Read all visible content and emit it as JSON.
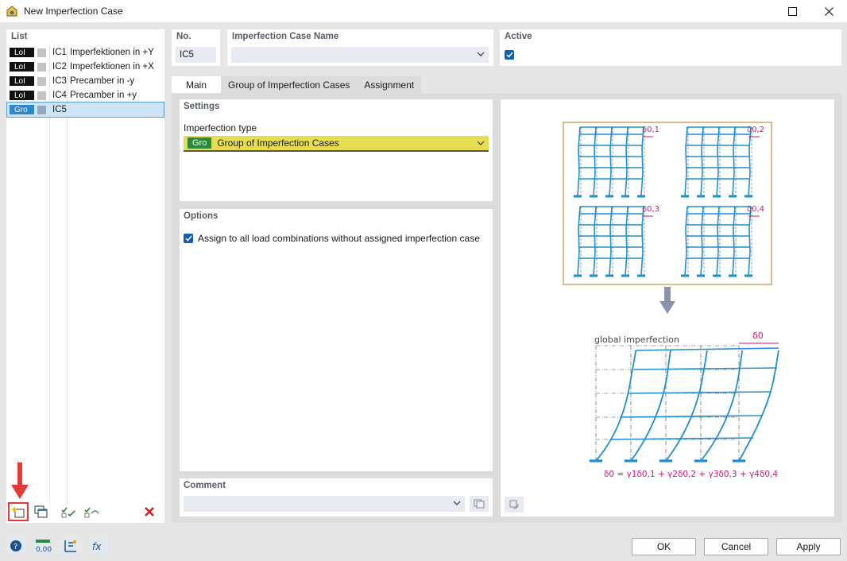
{
  "window": {
    "title": "New Imperfection Case"
  },
  "list": {
    "header": "List",
    "items": [
      {
        "tag": "LoI",
        "code": "IC1",
        "desc": "Imperfektionen in +Y",
        "selected": false
      },
      {
        "tag": "LoI",
        "code": "IC2",
        "desc": "Imperfektionen in +X",
        "selected": false
      },
      {
        "tag": "LoI",
        "code": "IC3",
        "desc": "Precamber in -y",
        "selected": false
      },
      {
        "tag": "LoI",
        "code": "IC4",
        "desc": "Precamber in +y",
        "selected": false
      },
      {
        "tag": "Gro",
        "code": "IC5",
        "desc": "",
        "selected": true
      }
    ]
  },
  "no": {
    "label": "No.",
    "value": "IC5"
  },
  "name": {
    "label": "Imperfection Case Name",
    "value": ""
  },
  "active": {
    "label": "Active",
    "checked": true
  },
  "tabs": [
    {
      "label": "Main",
      "active": true
    },
    {
      "label": "Group of Imperfection Cases",
      "active": false
    },
    {
      "label": "Assignment",
      "active": false
    }
  ],
  "settings": {
    "header": "Settings",
    "imperfection_type_label": "Imperfection type",
    "imperfection_type_tag": "Gro",
    "imperfection_type_value": "Group of Imperfection Cases"
  },
  "options": {
    "header": "Options",
    "assign_label": "Assign to all load combinations without assigned imperfection case",
    "assign_checked": true
  },
  "comment": {
    "header": "Comment",
    "value": ""
  },
  "diagram": {
    "labels": [
      "δ0,1",
      "δ0,2",
      "δ0,3",
      "δ0,4"
    ],
    "global_label": "global imperfection",
    "global_delta": "δ0",
    "formula": "δ0 = γ1δ0,1 + γ2δ0,2 + γ3δ0,3 + γ4δ0,4"
  },
  "buttons": {
    "ok": "OK",
    "cancel": "Cancel",
    "apply": "Apply"
  },
  "colors": {
    "accent": "#0f5fb4",
    "member": "#1f8fd0",
    "dimension": "#d4157a",
    "highlight": "#e53935",
    "type_field": "#e6dd52"
  }
}
